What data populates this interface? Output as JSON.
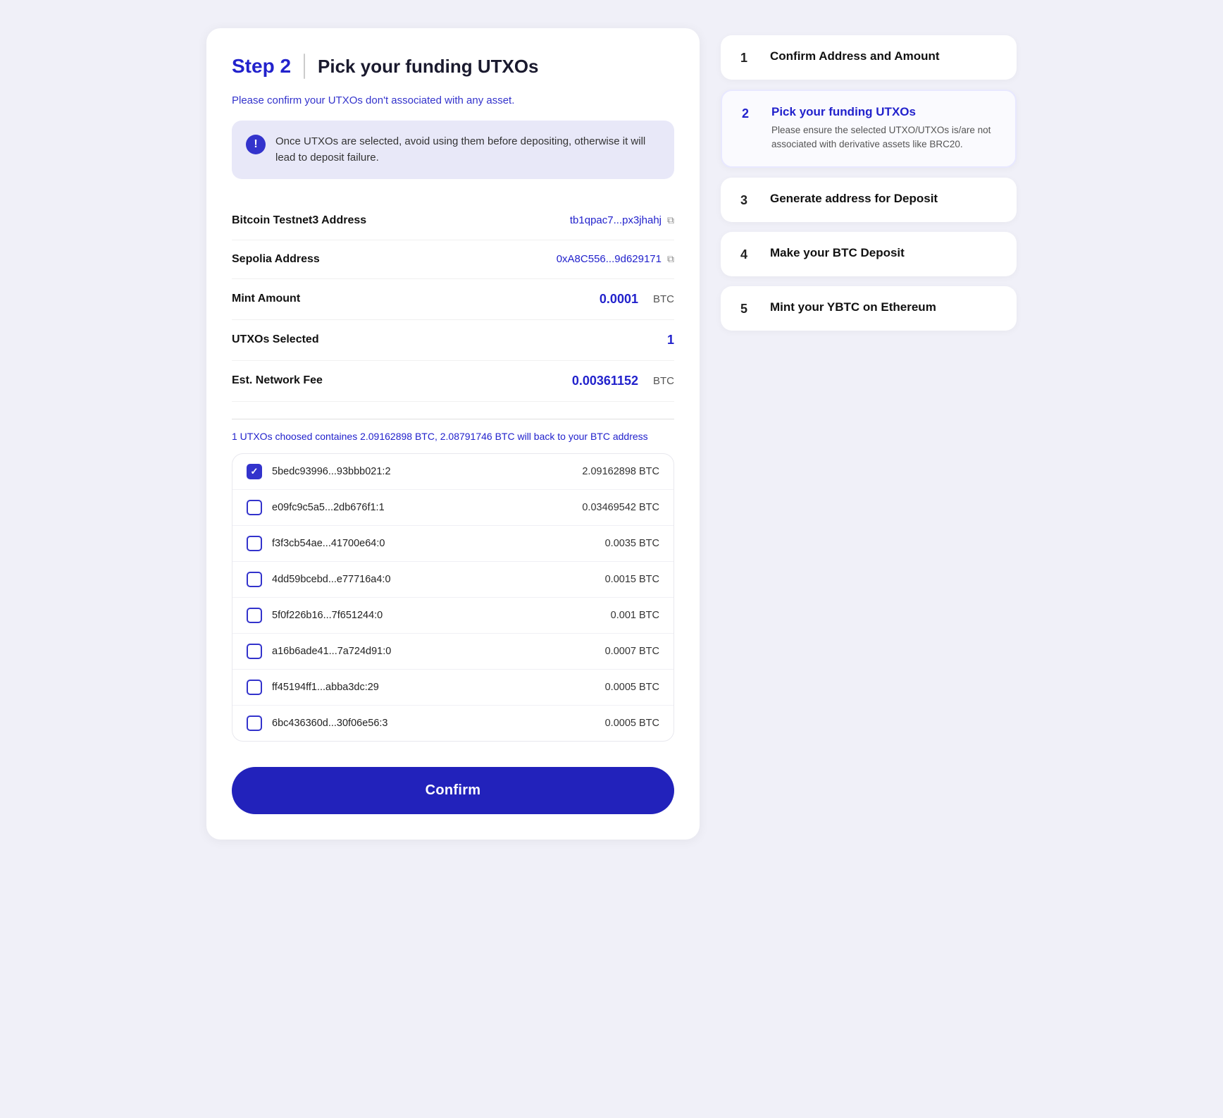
{
  "main": {
    "step_number": "Step 2",
    "step_separator": "|",
    "step_title": "Pick your funding UTXOs",
    "subtitle": "Please confirm your UTXOs don't associated with any asset.",
    "info_message": "Once UTXOs are selected, avoid using them before depositing, otherwise it will lead to deposit failure.",
    "fields": [
      {
        "label": "Bitcoin Testnet3 Address",
        "value": "tb1qpac7...px3jhahj",
        "type": "link",
        "has_copy": true
      },
      {
        "label": "Sepolia Address",
        "value": "0xA8C556...9d629171",
        "type": "link",
        "has_copy": true
      },
      {
        "label": "Mint Amount",
        "value": "0.0001",
        "unit": "BTC",
        "type": "blue"
      },
      {
        "label": "UTXOs Selected",
        "value": "1",
        "type": "blue"
      },
      {
        "label": "Est. Network Fee",
        "value": "0.00361152",
        "unit": "BTC",
        "type": "blue"
      }
    ],
    "utxo_summary": "1 UTXOs choosed containes 2.09162898 BTC, 2.08791746 BTC will back to your BTC address",
    "utxos": [
      {
        "id": "5bedc93996...93bbb021:2",
        "amount": "2.09162898 BTC",
        "checked": true
      },
      {
        "id": "e09fc9c5a5...2db676f1:1",
        "amount": "0.03469542 BTC",
        "checked": false
      },
      {
        "id": "f3f3cb54ae...41700e64:0",
        "amount": "0.0035 BTC",
        "checked": false
      },
      {
        "id": "4dd59bcebd...e77716a4:0",
        "amount": "0.0015 BTC",
        "checked": false
      },
      {
        "id": "5f0f226b16...7f651244:0",
        "amount": "0.001 BTC",
        "checked": false
      },
      {
        "id": "a16b6ade41...7a724d91:0",
        "amount": "0.0007 BTC",
        "checked": false
      },
      {
        "id": "ff45194ff1...abba3dc:29",
        "amount": "0.0005 BTC",
        "checked": false
      },
      {
        "id": "6bc436360d...30f06e56:3",
        "amount": "0.0005 BTC",
        "checked": false
      }
    ],
    "confirm_label": "Confirm"
  },
  "sidebar": {
    "steps": [
      {
        "num": "1",
        "title": "Confirm Address and Amount",
        "desc": "",
        "active": false
      },
      {
        "num": "2",
        "title": "Pick your funding UTXOs",
        "desc": "Please ensure the selected UTXO/UTXOs is/are not associated with derivative assets like BRC20.",
        "active": true
      },
      {
        "num": "3",
        "title": "Generate address for Deposit",
        "desc": "",
        "active": false
      },
      {
        "num": "4",
        "title": "Make your BTC Deposit",
        "desc": "",
        "active": false
      },
      {
        "num": "5",
        "title": "Mint your YBTC on Ethereum",
        "desc": "",
        "active": false
      }
    ]
  }
}
